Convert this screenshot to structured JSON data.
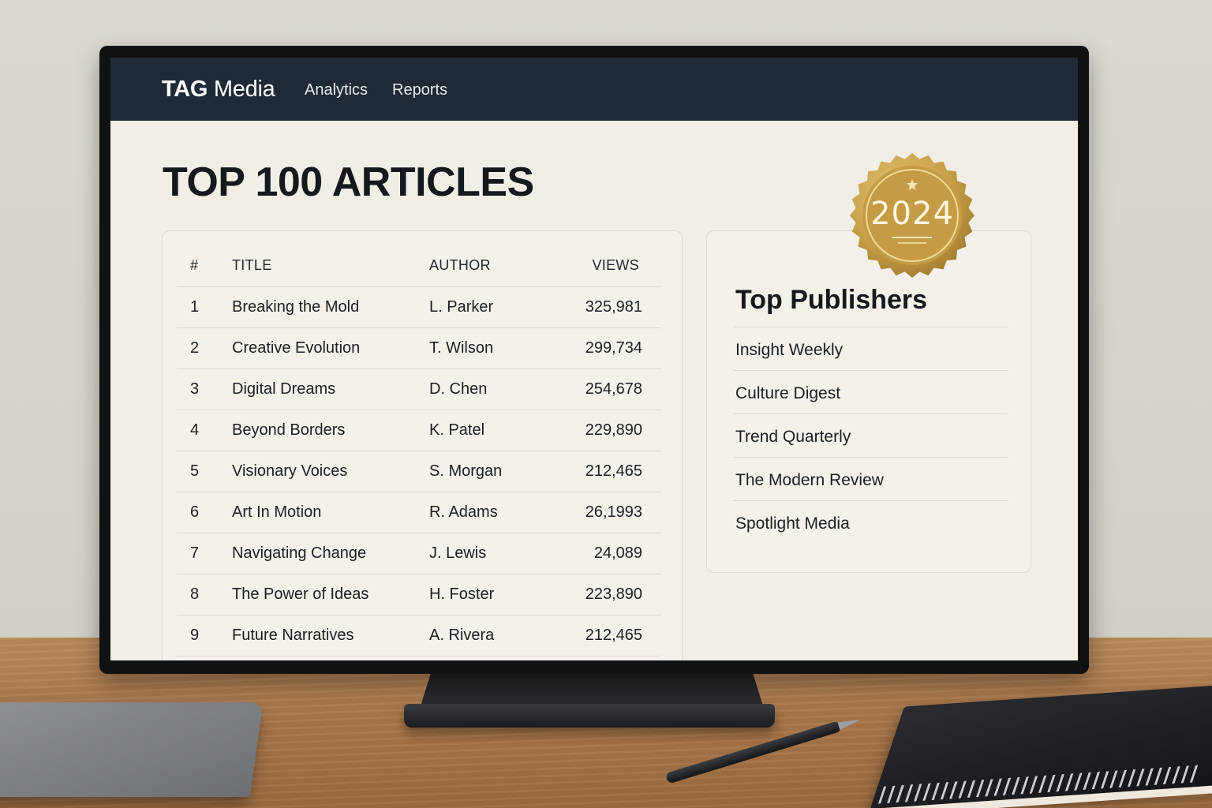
{
  "navbar": {
    "brand_bold": "TAG",
    "brand_regular": " Media",
    "links": [
      "Analytics",
      "Reports"
    ]
  },
  "page": {
    "title": "TOP 100 ARTICLES"
  },
  "table": {
    "columns": [
      "#",
      "TITLE",
      "AUTHOR",
      "VIEWS"
    ],
    "rows": [
      {
        "rank": "1",
        "title": "Breaking the Mold",
        "author": "L. Parker",
        "views": "325,981"
      },
      {
        "rank": "2",
        "title": "Creative Evolution",
        "author": "T. Wilson",
        "views": "299,734"
      },
      {
        "rank": "3",
        "title": "Digital Dreams",
        "author": "D. Chen",
        "views": "254,678"
      },
      {
        "rank": "4",
        "title": "Beyond Borders",
        "author": "K. Patel",
        "views": "229,890"
      },
      {
        "rank": "5",
        "title": "Visionary Voices",
        "author": "S. Morgan",
        "views": "212,465"
      },
      {
        "rank": "6",
        "title": "Art In Motion",
        "author": "R. Adams",
        "views": "26,1993"
      },
      {
        "rank": "7",
        "title": "Navigating Change",
        "author": "J. Lewis",
        "views": "24,089"
      },
      {
        "rank": "8",
        "title": "The Power of Ideas",
        "author": "H. Foster",
        "views": "223,890"
      },
      {
        "rank": "9",
        "title": "Future Narratives",
        "author": "A. Rivera",
        "views": "212,465"
      }
    ]
  },
  "publishers": {
    "title": "Top Publishers",
    "items": [
      "Insight Weekly",
      "Culture Digest",
      "Trend Quarterly",
      "The Modern Review",
      "Spotlight Media"
    ]
  },
  "badge": {
    "year": "2024",
    "icon": "star-icon"
  },
  "colors": {
    "navbar_bg": "#1f2a36",
    "screen_bg": "#f1eee6",
    "badge_gold": "#c9a14a"
  }
}
